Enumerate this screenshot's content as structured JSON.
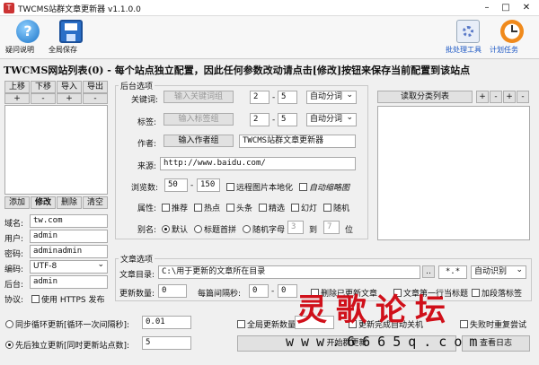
{
  "window": {
    "title": "TWCMS站群文章更新器 v1.1.0.0",
    "minimize": "–",
    "maximize": "□",
    "close": "✕"
  },
  "toolbar": {
    "help_label": "疑问说明",
    "save_all_label": "全局保存",
    "batch_label": "批处理工具",
    "schedule_label": "计划任务"
  },
  "headline": "TWCMS网站列表(0) - 每个站点独立配置，因此任何参数改动请点击[修改]按钮来保存当前配置到该站点",
  "site_list": {
    "buttons_top": [
      "上移",
      "下移",
      "导入",
      "导出"
    ],
    "plus_minus": [
      "+",
      "-",
      "+",
      "-"
    ],
    "buttons_bottom": [
      "添加",
      "修改",
      "删除",
      "清空"
    ],
    "fields": [
      {
        "label": "域名:",
        "value": "tw.com"
      },
      {
        "label": "用户:",
        "value": "admin"
      },
      {
        "label": "密码:",
        "value": "adminadmin"
      },
      {
        "label": "编码:",
        "value": "UTF-8"
      },
      {
        "label": "后台:",
        "value": "admin"
      }
    ],
    "protocol_label": "协议:",
    "https_label": "使用 HTTPS 发布"
  },
  "backend": {
    "group_title": "后台选项",
    "keyword_label": "关键词:",
    "keyword_btn": "输入关键词组",
    "keyword_min": "2",
    "keyword_max": "5",
    "keyword_mode": "自动分词",
    "tag_label": "标签:",
    "tag_btn": "输入标签组",
    "tag_min": "2",
    "tag_max": "5",
    "tag_mode": "自动分词",
    "author_label": "作者:",
    "author_btn": "输入作者组",
    "author_value": "TWCMS站群文章更新器",
    "source_label": "来源:",
    "source_value": "http://www.baidu.com/",
    "views_label": "浏览数:",
    "views_min": "50",
    "views_max": "150",
    "dash": "-",
    "localize_label": "远程图片本地化",
    "thumb_label": "自动缩略图",
    "attr_label": "属性:",
    "attrs": [
      "推荐",
      "热点",
      "头条",
      "精选",
      "幻灯",
      "随机"
    ],
    "alias_label": "别名:",
    "alias_opts": [
      "默认",
      "标题首拼",
      "随机字母"
    ],
    "alias_min": "3",
    "alias_to": "到",
    "alias_max": "7",
    "alias_unit": "位"
  },
  "categories": {
    "read_btn": "读取分类列表",
    "plus_minus": [
      "+",
      "-",
      "+",
      "-"
    ]
  },
  "article": {
    "group_title": "文章选项",
    "dir_label": "文章目录:",
    "dir_value": "C:\\用于更新的文章所在目录",
    "browse": "..",
    "ext": "*.*",
    "detect": "自动识别",
    "count_label": "更新数量:",
    "count_value": "0",
    "interval_label": "每篇间隔秒:",
    "interval_min": "0",
    "interval_max": "0",
    "delete_label": "删除已更新文章",
    "first_line_label": "文章第一行当标题",
    "tag_label": "加段落标签"
  },
  "bottom": {
    "sync_label": "同步循环更新[循环一次间隔秒]:",
    "sync_value": "0.01",
    "indep_label": "先后独立更新[同时更新站点数]:",
    "indep_value": "5",
    "global_count_label": "全局更新数量",
    "auto_shutdown_label": "更新完成自动关机",
    "retry_label": "失败时重复尝试",
    "start_btn": "开始群更新",
    "log_btn": "查看日志"
  },
  "watermark": {
    "text": "灵歌论坛",
    "url": "www.6665q.com"
  }
}
